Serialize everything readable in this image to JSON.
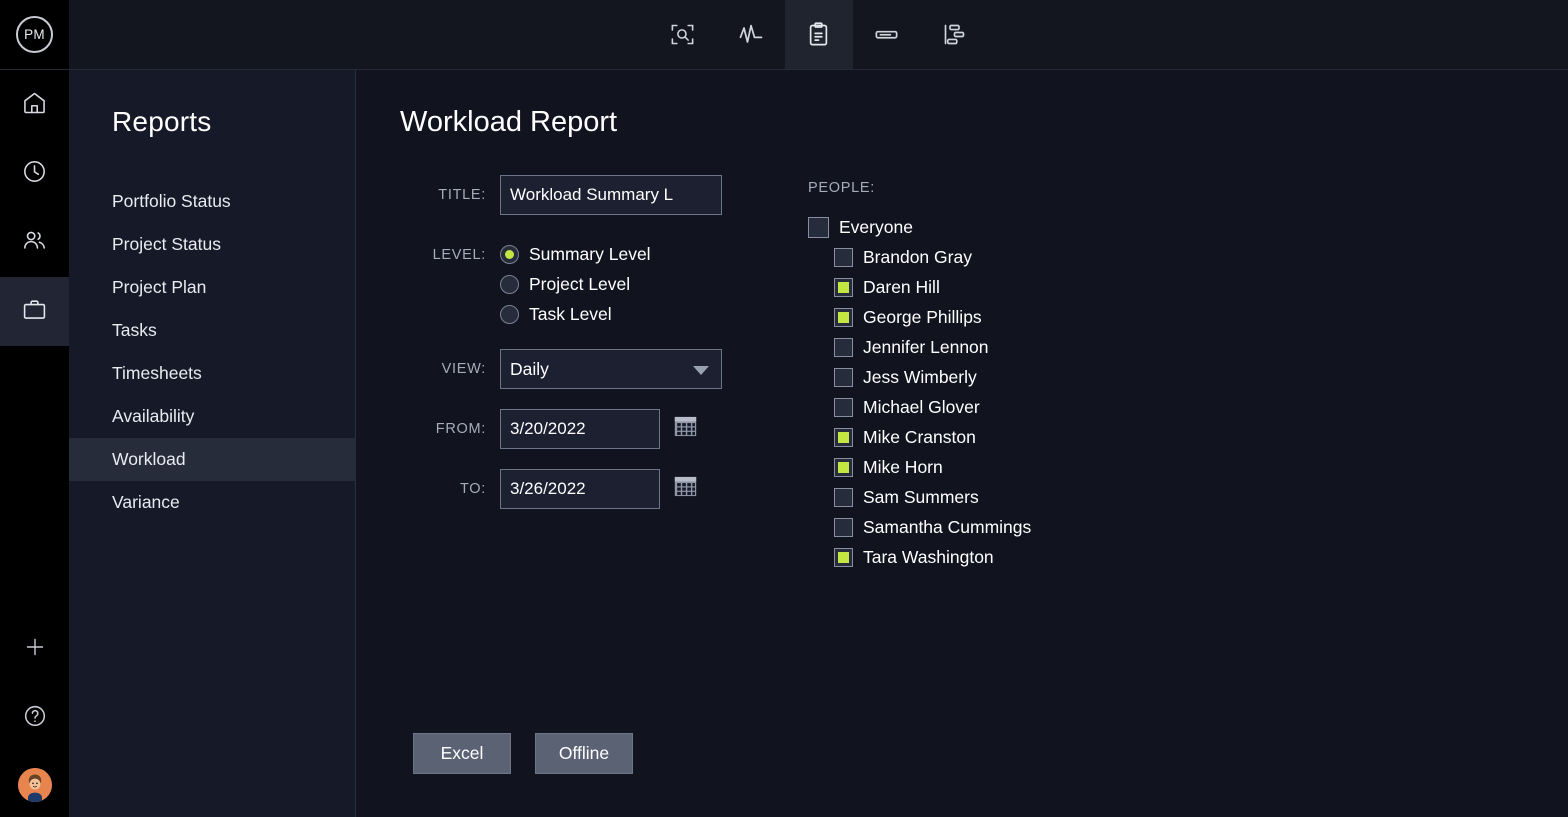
{
  "brand": {
    "logo_text": "PM"
  },
  "topnav": [
    {
      "name": "overview-zoom-icon",
      "label": "Overview",
      "active": false
    },
    {
      "name": "activity-icon",
      "label": "Activity",
      "active": false
    },
    {
      "name": "clipboard-icon",
      "label": "Reports",
      "active": true
    },
    {
      "name": "board-icon",
      "label": "Board",
      "active": false
    },
    {
      "name": "gantt-icon",
      "label": "Gantt",
      "active": false
    }
  ],
  "rail": [
    {
      "name": "home-icon",
      "label": "Home",
      "active": false
    },
    {
      "name": "clock-icon",
      "label": "Timesheets",
      "active": false
    },
    {
      "name": "people-icon",
      "label": "Team",
      "active": false
    },
    {
      "name": "briefcase-icon",
      "label": "Projects",
      "active": true
    }
  ],
  "rail_bottom": [
    {
      "name": "plus-icon",
      "label": "Add"
    },
    {
      "name": "help-icon",
      "label": "Help"
    },
    {
      "name": "avatar",
      "label": "Account"
    }
  ],
  "sidebar": {
    "title": "Reports",
    "items": [
      {
        "label": "Portfolio Status",
        "active": false
      },
      {
        "label": "Project Status",
        "active": false
      },
      {
        "label": "Project Plan",
        "active": false
      },
      {
        "label": "Tasks",
        "active": false
      },
      {
        "label": "Timesheets",
        "active": false
      },
      {
        "label": "Availability",
        "active": false
      },
      {
        "label": "Workload",
        "active": true
      },
      {
        "label": "Variance",
        "active": false
      }
    ]
  },
  "main": {
    "title": "Workload Report",
    "labels": {
      "title": "TITLE:",
      "level": "LEVEL:",
      "view": "VIEW:",
      "from": "FROM:",
      "to": "TO:",
      "people": "PEOPLE:"
    },
    "title_input": {
      "value": "Workload Summary L",
      "placeholder": ""
    },
    "levels": [
      {
        "label": "Summary Level",
        "selected": true
      },
      {
        "label": "Project Level",
        "selected": false
      },
      {
        "label": "Task Level",
        "selected": false
      }
    ],
    "view_select": {
      "value": "Daily"
    },
    "from_date": {
      "value": "3/20/2022"
    },
    "to_date": {
      "value": "3/26/2022"
    },
    "people": [
      {
        "label": "Everyone",
        "checked": false,
        "group": true
      },
      {
        "label": "Brandon Gray",
        "checked": false,
        "group": false
      },
      {
        "label": "Daren Hill",
        "checked": true,
        "group": false
      },
      {
        "label": "George Phillips",
        "checked": true,
        "group": false
      },
      {
        "label": "Jennifer Lennon",
        "checked": false,
        "group": false
      },
      {
        "label": "Jess Wimberly",
        "checked": false,
        "group": false
      },
      {
        "label": "Michael Glover",
        "checked": false,
        "group": false
      },
      {
        "label": "Mike Cranston",
        "checked": true,
        "group": false
      },
      {
        "label": "Mike Horn",
        "checked": true,
        "group": false
      },
      {
        "label": "Sam Summers",
        "checked": false,
        "group": false
      },
      {
        "label": "Samantha Cummings",
        "checked": false,
        "group": false
      },
      {
        "label": "Tara Washington",
        "checked": true,
        "group": false
      }
    ],
    "buttons": [
      {
        "label": "Excel",
        "name": "excel-button"
      },
      {
        "label": "Offline",
        "name": "offline-button"
      }
    ]
  },
  "colors": {
    "accent": "#c3e643",
    "background": "#11131f",
    "sidebar": "#161927",
    "rail": "#000000",
    "active_row": "#272c3a",
    "button": "#5a6273",
    "avatar": "#e8854f"
  }
}
